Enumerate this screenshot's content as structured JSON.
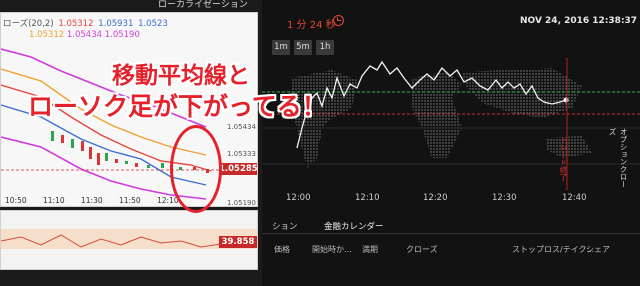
{
  "left_panel": {
    "title": "ローカライゼーション",
    "legend": {
      "label": "ローズ(20,2)",
      "v1": "1.05312",
      "v2": "1.05931",
      "v3": "1.0523",
      "row2_v1": "1.05312",
      "row2_v2": "1.05434",
      "row2_v3": "1.05190"
    },
    "y_ticks": [
      "1.05434",
      "1.05333",
      "1.05190"
    ],
    "price_tag": "1.05285",
    "x_ticks": [
      "10:50",
      "11:10",
      "11:30",
      "11:50",
      "12:10"
    ],
    "oscillator_tag": "39.858"
  },
  "right_panel": {
    "timer": "1 分 24 秒",
    "datetime": "NOV 24, 2016 12:38:37",
    "timeframes": [
      "1m",
      "5m",
      "1h"
    ],
    "x_ticks": [
      "12:00",
      "12:10",
      "12:20",
      "12:30",
      "12:40"
    ],
    "expiry_label": "オプションクローズ",
    "vertical_label": "トレード終了",
    "tabs": [
      "ション",
      "金融カレンダー"
    ],
    "columns": [
      "価格",
      "開始時か...",
      "満期",
      "クローズ",
      "ストップロス/テイク...",
      "シェア"
    ]
  },
  "overlay": {
    "line1": "移動平均線と",
    "line2": "ローソク足が下がってる！"
  },
  "colors": {
    "legend_red": "#e8443a",
    "legend_orange": "#f0a030",
    "legend_blue": "#3a6fd8",
    "legend_pink": "#d03adf",
    "accent_red": "#e5212b"
  }
}
